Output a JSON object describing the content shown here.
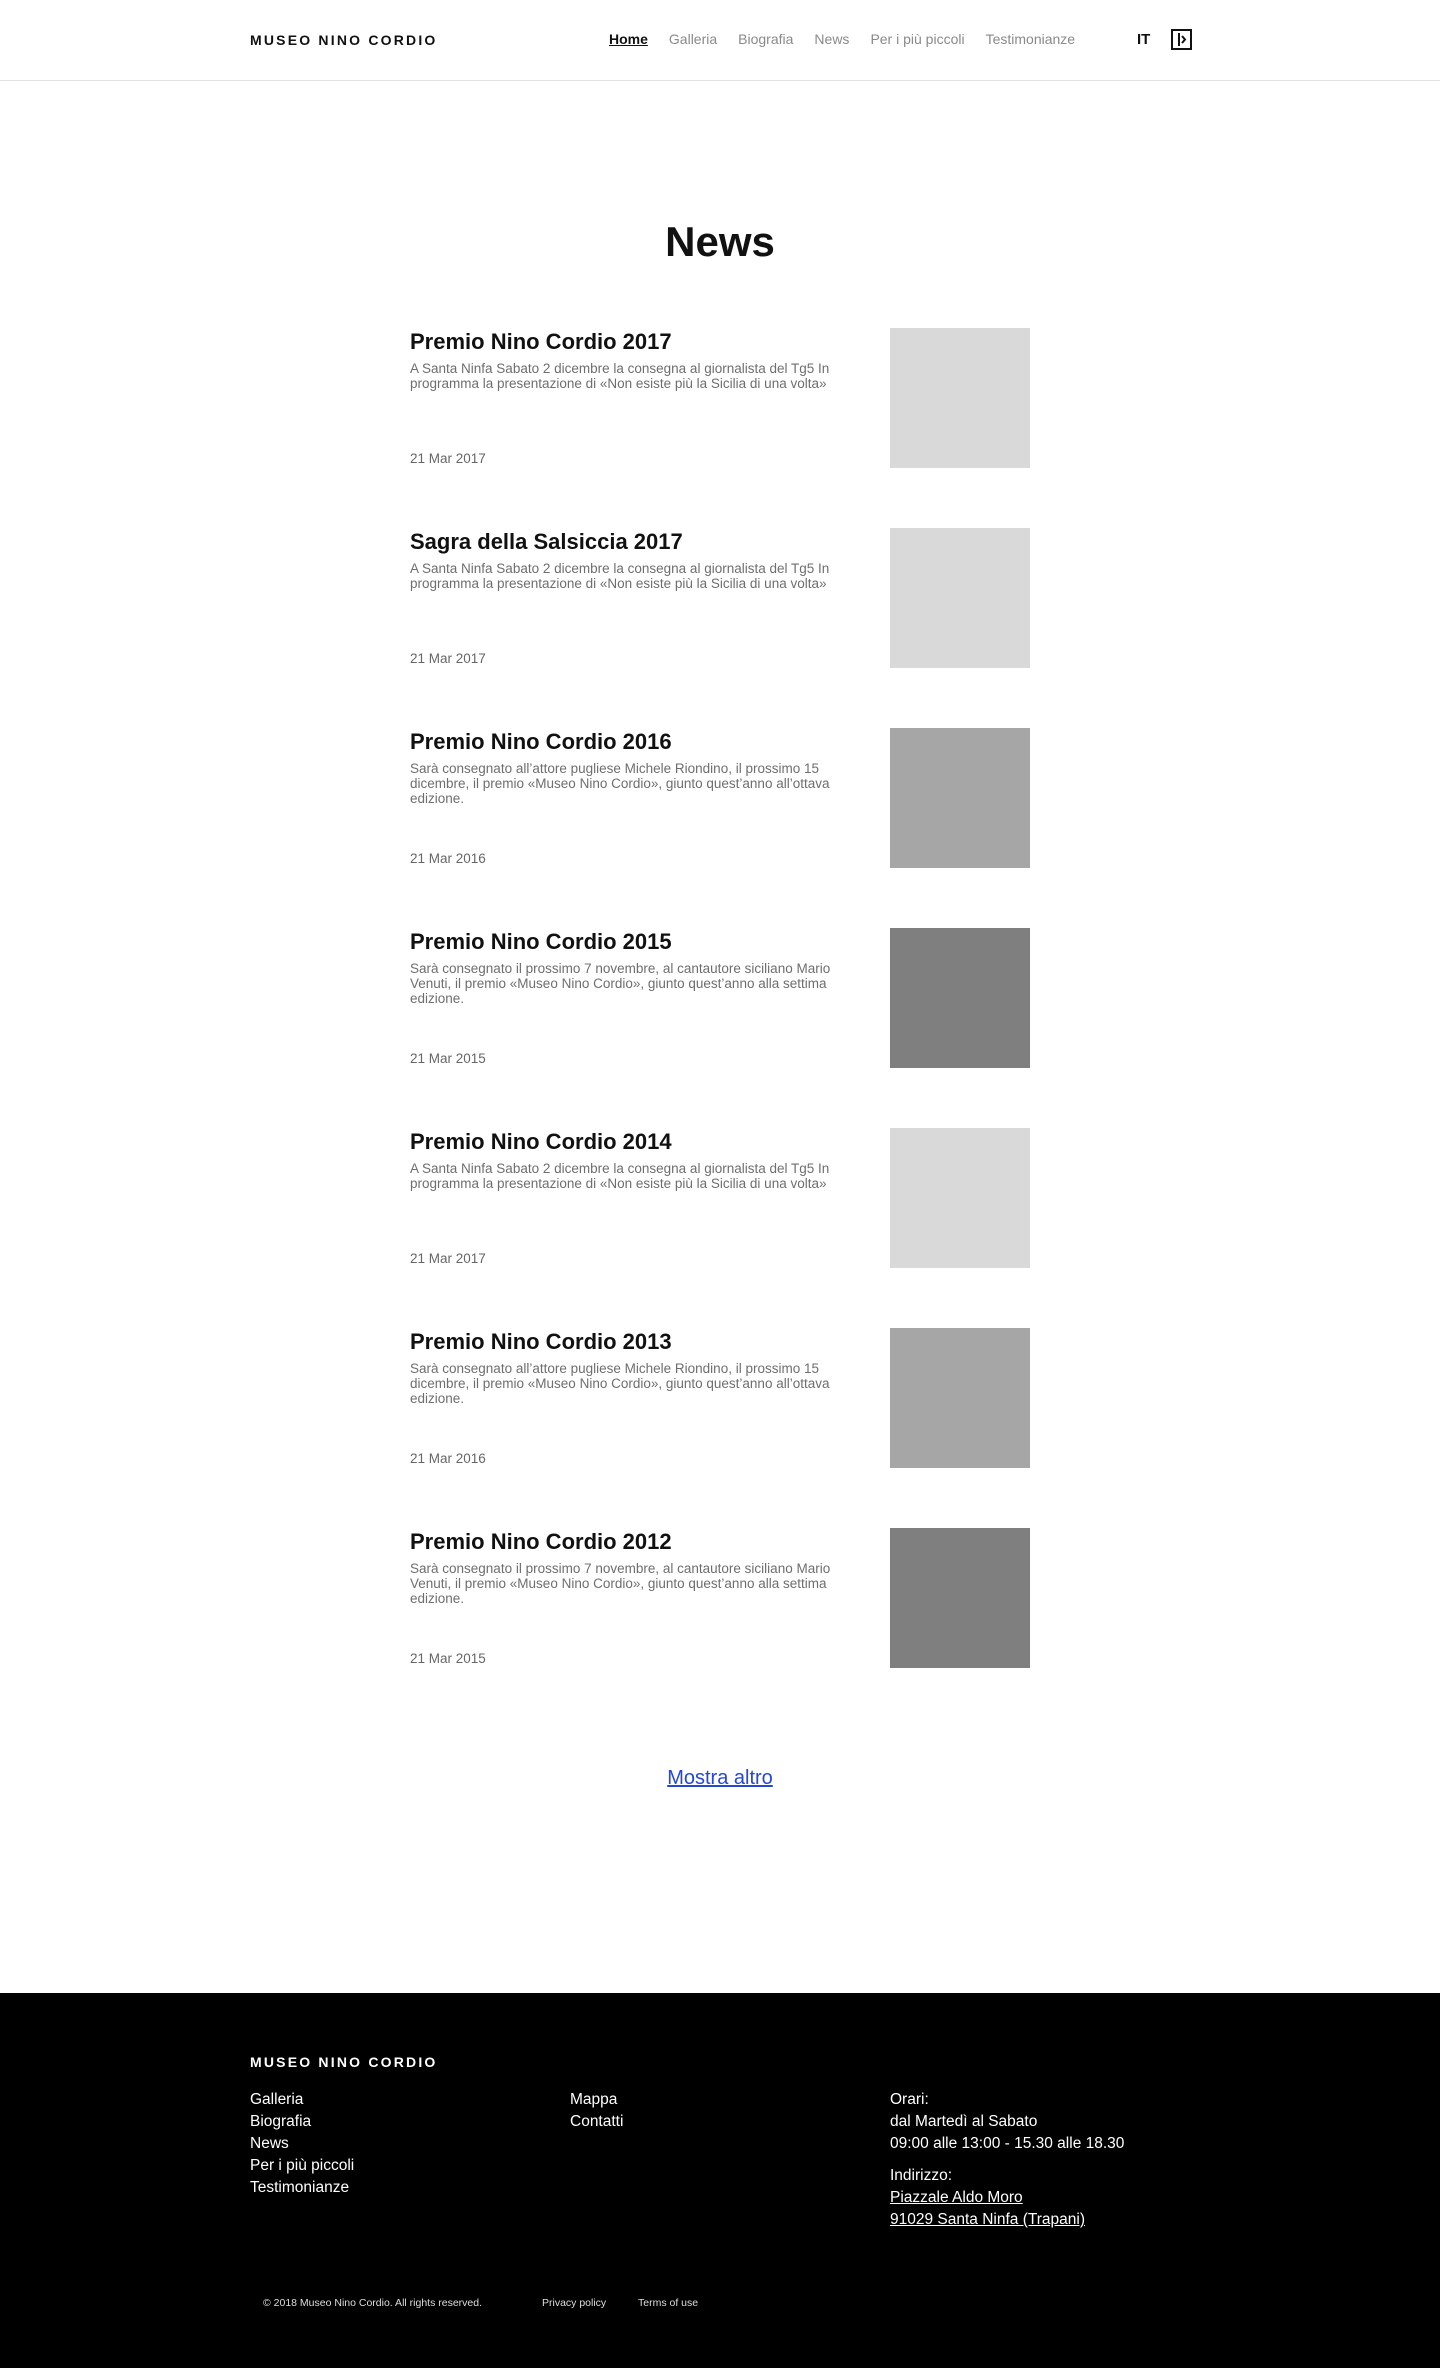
{
  "header": {
    "logo": "MUSEO NINO CORDIO",
    "nav": [
      "Home",
      "Galleria",
      "Biografia",
      "News",
      "Per i più piccoli",
      "Testimonianze"
    ],
    "active_nav": "Home",
    "language": "IT"
  },
  "page_title": "News",
  "news": [
    {
      "title": "Premio Nino Cordio 2017",
      "description": "A Santa Ninfa Sabato 2 dicembre la consegna al giornalista del Tg5 In programma la presentazione di «Non esiste più la Sicilia di una volta»",
      "date": "21 Mar 2017",
      "thumb_color": "#d9d9d9"
    },
    {
      "title": "Sagra della Salsiccia 2017",
      "description": "A Santa Ninfa Sabato 2 dicembre la consegna al giornalista del Tg5 In programma la presentazione di «Non esiste più la Sicilia di una volta»",
      "date": "21 Mar 2017",
      "thumb_color": "#d9d9d9"
    },
    {
      "title": "Premio Nino Cordio 2016",
      "description": "Sarà consegnato all’attore pugliese Michele Riondino, il prossimo 15 dicembre, il premio «Museo Nino Cordio», giunto quest’anno all’ottava edizione.",
      "date": "21 Mar 2016",
      "thumb_color": "#a6a6a6"
    },
    {
      "title": "Premio Nino Cordio 2015",
      "description": "Sarà consegnato il prossimo 7 novembre, al cantautore siciliano Mario Venuti, il premio «Museo Nino Cordio», giunto quest’anno alla settima edizione.",
      "date": "21 Mar 2015",
      "thumb_color": "#7f7f7f"
    },
    {
      "title": "Premio Nino Cordio 2014",
      "description": "A Santa Ninfa Sabato 2 dicembre la consegna al giornalista del Tg5 In programma la presentazione di «Non esiste più la Sicilia di una volta»",
      "date": "21 Mar 2017",
      "thumb_color": "#d9d9d9"
    },
    {
      "title": "Premio Nino Cordio 2013",
      "description": "Sarà consegnato all’attore pugliese Michele Riondino, il prossimo 15 dicembre, il premio «Museo Nino Cordio», giunto quest’anno all’ottava edizione.",
      "date": "21 Mar 2016",
      "thumb_color": "#a6a6a6"
    },
    {
      "title": "Premio Nino Cordio 2012",
      "description": "Sarà consegnato il prossimo 7 novembre, al cantautore siciliano Mario Venuti, il premio «Museo Nino Cordio», giunto quest’anno alla settima edizione.",
      "date": "21 Mar 2015",
      "thumb_color": "#7f7f7f"
    }
  ],
  "show_more": "Mostra altro",
  "footer": {
    "logo": "MUSEO NINO CORDIO",
    "col1": [
      "Galleria",
      "Biografia",
      "News",
      "Per i più piccoli",
      "Testimonianze"
    ],
    "col2": [
      "Mappa",
      "Contatti"
    ],
    "hours_label": "Orari:",
    "hours_days": "dal Martedì al Sabato",
    "hours_time": "09:00 alle 13:00 - 15.30 alle 18.30",
    "address_label": "Indirizzo:",
    "address_line1": "Piazzale Aldo Moro",
    "address_line2": "91029 Santa Ninfa (Trapani)",
    "copyright": "© 2018 Museo Nino Cordio. All rights reserved.",
    "privacy": "Privacy policy",
    "terms": "Terms of use"
  },
  "icons": {
    "menu": "menu-panel-icon"
  }
}
